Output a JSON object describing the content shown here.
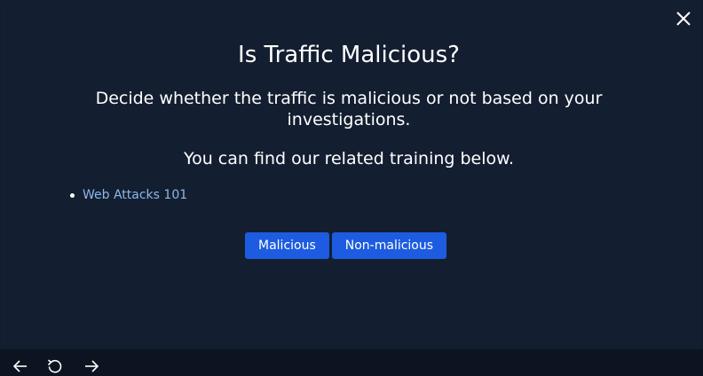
{
  "modal": {
    "title": "Is Traffic Malicious?",
    "description": "Decide whether the traffic is malicious or not based on your investigations.",
    "training_text": "You can find our related training below.",
    "links": [
      {
        "label": "Web Attacks 101"
      }
    ],
    "buttons": {
      "malicious": "Malicious",
      "non_malicious": "Non-malicious"
    }
  },
  "icons": {
    "close": "close-icon",
    "back": "arrow-left-icon",
    "refresh": "refresh-icon",
    "forward": "arrow-right-icon"
  },
  "colors": {
    "background": "#131e30",
    "accent": "#1d5ce0",
    "link": "#8db8e8",
    "text": "#ffffff"
  }
}
